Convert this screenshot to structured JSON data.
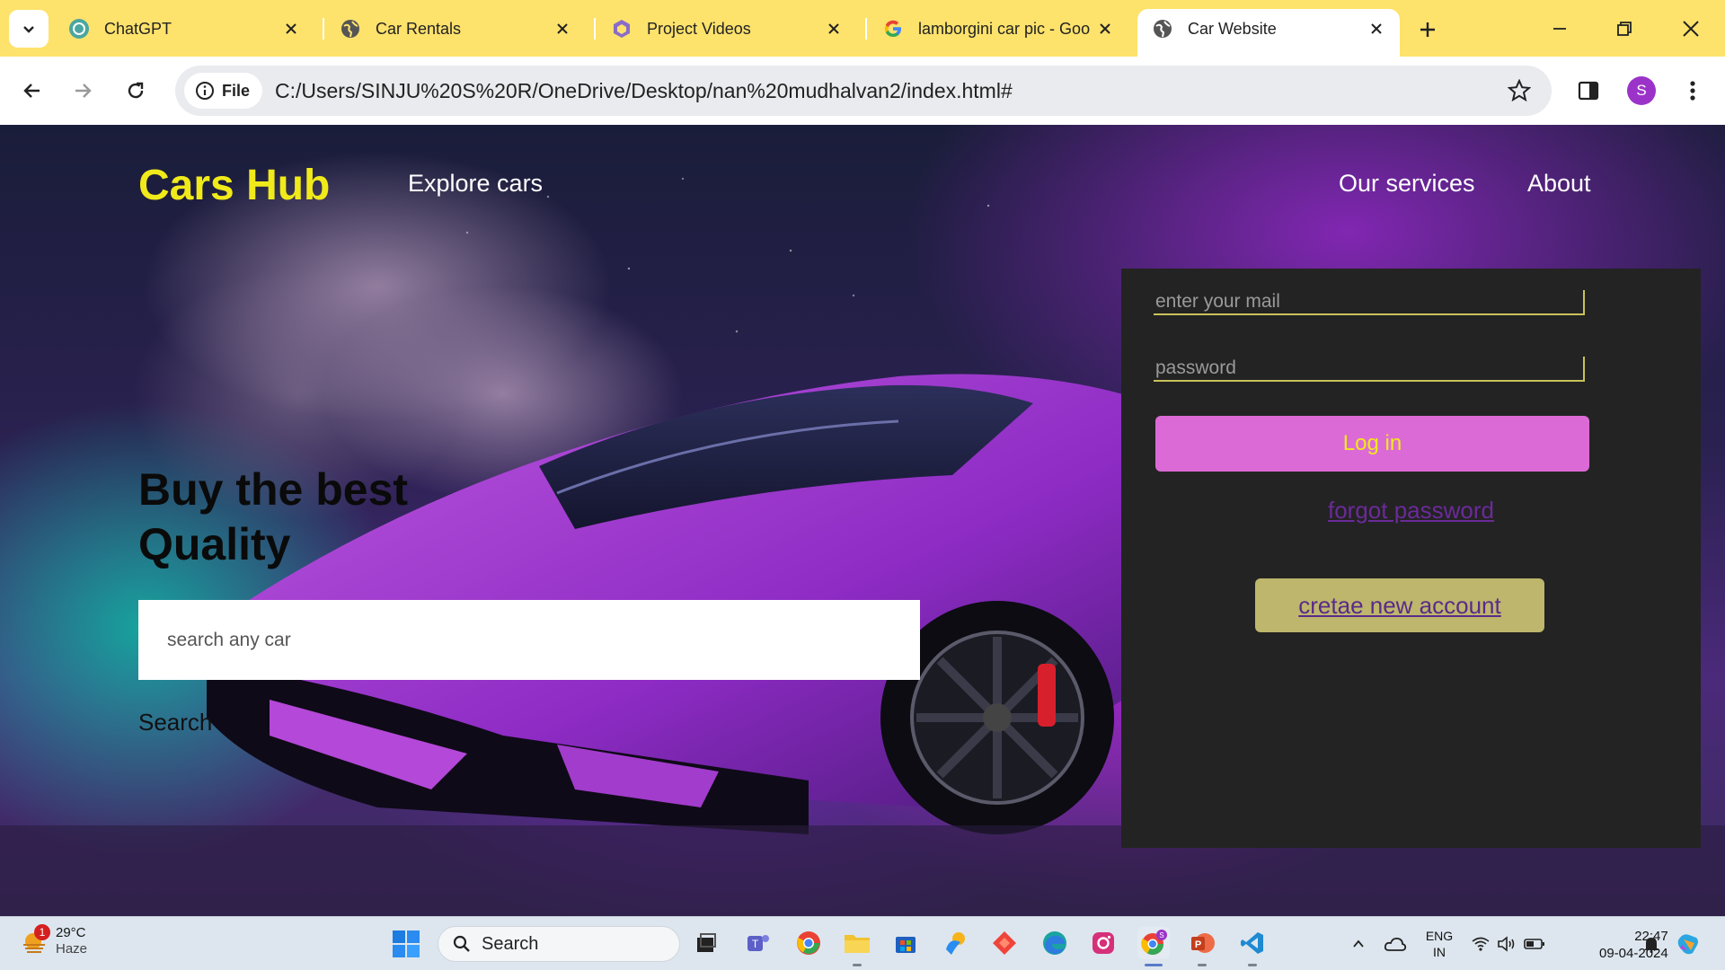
{
  "browser": {
    "tabs": [
      {
        "title": "ChatGPT",
        "icon": "chatgpt-icon"
      },
      {
        "title": "Car Rentals",
        "icon": "globe-icon"
      },
      {
        "title": "Project Videos",
        "icon": "project-icon"
      },
      {
        "title": "lamborgini car pic - Goo",
        "icon": "google-icon"
      },
      {
        "title": "Car Website",
        "icon": "globe-icon",
        "active": true
      }
    ],
    "address": {
      "chip_label": "File",
      "url": "C:/Users/SINJU%20S%20R/OneDrive/Desktop/nan%20mudhalvan2/index.html#"
    },
    "profile_initial": "S",
    "colors": {
      "tabstrip": "#fde26c"
    }
  },
  "site": {
    "brand": "Cars Hub",
    "nav": {
      "explore": "Explore cars",
      "services": "Our services",
      "about": "About"
    },
    "hero": {
      "title": "Buy the best Quality",
      "search_placeholder": "search any car",
      "search_label": "Search"
    },
    "login": {
      "email_placeholder": "enter your mail",
      "password_placeholder": "password",
      "login_button": "Log in",
      "forgot": "forgot password",
      "create_account": "cretae new account"
    },
    "colors": {
      "brand": "#f0ea1a",
      "login_button": "#dc6ad6",
      "create_button": "#bdb66c",
      "panel": "#232323"
    }
  },
  "taskbar": {
    "weather": {
      "temp": "29°C",
      "condition": "Haze",
      "badge": "1"
    },
    "search_label": "Search",
    "language": {
      "line1": "ENG",
      "line2": "IN"
    },
    "clock": {
      "time": "22:47",
      "date": "09-04-2024"
    }
  }
}
